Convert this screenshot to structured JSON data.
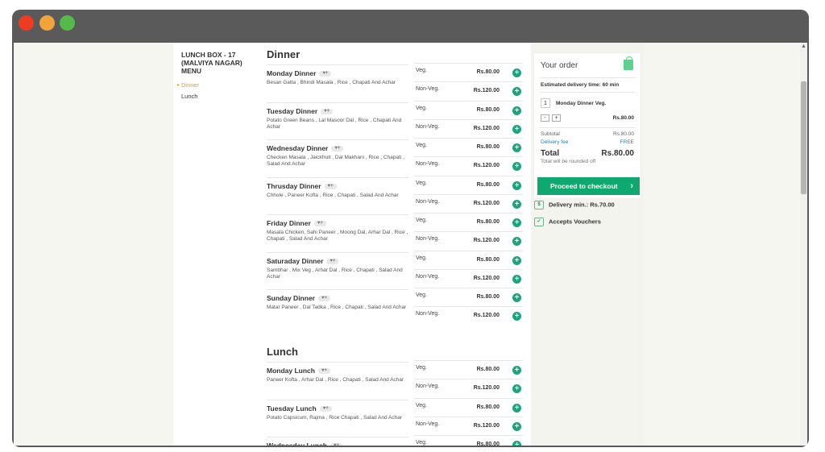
{
  "window": {
    "buttons": [
      "close",
      "minimize",
      "maximize"
    ]
  },
  "menu": {
    "title": "LUNCH BOX - 17 (MALVIYA NAGAR) MENU",
    "links": [
      {
        "label": "Dinner",
        "active": true
      },
      {
        "label": "Lunch",
        "active": false
      }
    ]
  },
  "sections": [
    {
      "title": "Dinner",
      "items": [
        {
          "name": "Monday Dinner",
          "desc": "Besan Gatta , Bhindi Masala , Rice , Chapati And Achar"
        },
        {
          "name": "Tuesday Dinner",
          "desc": "Potato Green Beans , Lal Masoor Dal , Rice , Chapati And Achar"
        },
        {
          "name": "Wednesday Dinner",
          "desc": "Checken Masala , Jaickfruit , Dal Makhani , Rice , Chapati , Salad And Achar"
        },
        {
          "name": "Thrusday Dinner",
          "desc": "Chhole , Paneer Kofta , Rice , Chapati , Salad And Achar"
        },
        {
          "name": "Friday Dinner",
          "desc": "Masala Chicken, Sahi Paneer , Moong Dal, Arhar Dal , Rice , Chapati , Salad And Achar"
        },
        {
          "name": "Saturaday Dinner",
          "desc": "Sambhar , Mix Veg , Arhar Dal , Rice , Chapati , Salad And Achar"
        },
        {
          "name": "Sunday Dinner",
          "desc": "Matar Paneer , Dal Tadka , Rice , Chapati , Salad And Achar"
        }
      ]
    },
    {
      "title": "Lunch",
      "items": [
        {
          "name": "Monday Lunch",
          "desc": "Paneer Kofta , Arhar Dal , Rice , Chapati , Salad And Achar"
        },
        {
          "name": "Tuesday Lunch",
          "desc": "Potato Capsicum, Rajma , Rice Chapati , Salad And Achar"
        },
        {
          "name": "Wednesday Lunch",
          "desc": ""
        }
      ]
    }
  ],
  "variants": {
    "veg_label": "Veg.",
    "veg_price": "Rs.80.00",
    "nonveg_label": "Non-Veg.",
    "nonveg_price": "Rs.120.00",
    "add_symbol": "+"
  },
  "fav_symbol": "♥+",
  "cart": {
    "title": "Your order",
    "delivery_time": "Estimated delivery time: 60 min",
    "line_qty": "1",
    "line_name": "Monday Dinner Veg.",
    "line_price": "Rs.80.00",
    "minus": "-",
    "plus": "+",
    "subtotal_label": "Subtotal",
    "subtotal_value": "Rs.80.00",
    "delivery_fee_label": "Delivery fee",
    "delivery_fee_value": "FREE",
    "total_label": "Total",
    "total_value": "Rs.80.00",
    "rounding_note": "Total will be rounded off",
    "checkout_label": "Proceed to checkout",
    "checkout_chevron": "›"
  },
  "info": {
    "delivery_min": "Delivery min.: Rs.70.00",
    "vouchers": "Accepts Vouchers"
  }
}
